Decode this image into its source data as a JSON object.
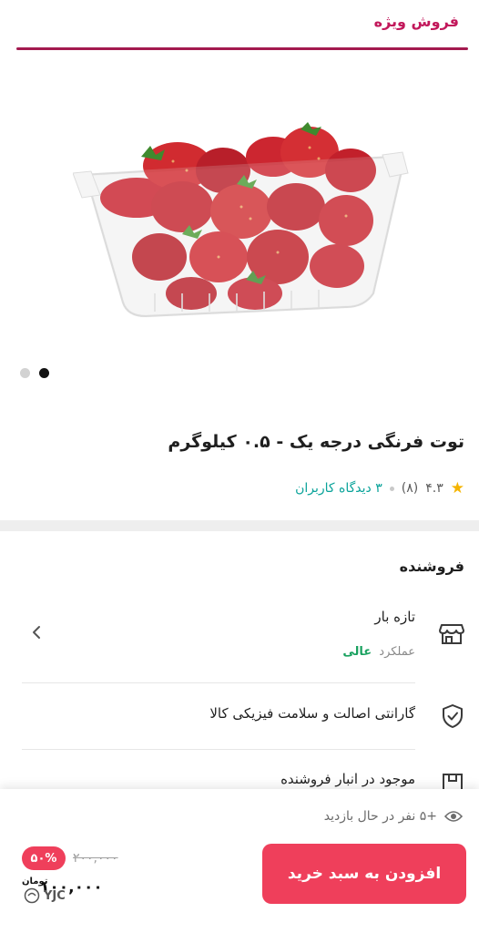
{
  "header": {
    "title": "فروش ویژه",
    "accent_color": "#a31a4f"
  },
  "gallery": {
    "image_name": "strawberry-container-image",
    "slide_count": 2,
    "active_slide": 2
  },
  "product": {
    "title": "توت فرنگی درجه یک - ۰.۵  کیلوگرم",
    "rating": "۴.۳",
    "rating_count": "(۸)",
    "reviews_link": "۳ دیدگاه کاربران"
  },
  "seller": {
    "section_title": "فروشنده",
    "name": "تازه بار",
    "performance_label": "عملکرد",
    "performance_value": "عالی",
    "icon": "shop-icon"
  },
  "features": [
    {
      "icon": "shield-check-icon",
      "text": "گارانتی اصالت و سلامت فیزیکی کالا"
    },
    {
      "icon": "warehouse-icon",
      "text": "موجود در انبار فروشنده"
    }
  ],
  "bottom_bar": {
    "viewers_text": "+۵ نفر در حال بازدید",
    "add_to_cart_label": "افزودن به سبد خرید",
    "discount": "۵۰%",
    "old_price": "۲۰۰,۰۰۰",
    "new_price": "۱۰۰,۰۰۰",
    "currency": "تومان",
    "watermark": "YJC",
    "brand_color": "#ef3f5b"
  }
}
